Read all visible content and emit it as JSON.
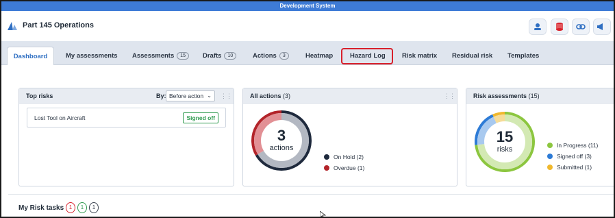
{
  "environment_banner": "Development System",
  "app": {
    "title": "Part 145 Operations"
  },
  "header_buttons": [
    {
      "name": "user-hat-icon"
    },
    {
      "name": "database-icon"
    },
    {
      "name": "link-icon"
    },
    {
      "name": "megaphone-icon"
    }
  ],
  "tabs": [
    {
      "label": "Dashboard",
      "count": null,
      "active": true
    },
    {
      "label": "My assessments",
      "count": null
    },
    {
      "label": "Assessments",
      "count": "15"
    },
    {
      "label": "Drafts",
      "count": "10"
    },
    {
      "label": "Actions",
      "count": "3"
    },
    {
      "label": "Heatmap",
      "count": null
    },
    {
      "label": "Hazard Log",
      "count": null,
      "highlighted": true
    },
    {
      "label": "Risk matrix",
      "count": null
    },
    {
      "label": "Residual risk",
      "count": null
    },
    {
      "label": "Templates",
      "count": null
    }
  ],
  "top_risks": {
    "title": "Top risks",
    "by_label": "By:",
    "by_value": "Before action",
    "rows": [
      {
        "name": "Lost Tool on Aircraft",
        "status": "Signed off"
      }
    ]
  },
  "all_actions": {
    "title": "All actions",
    "count": "(3)",
    "total": "3",
    "unit": "actions",
    "legend": [
      {
        "label": "On Hold (2)",
        "value": 2,
        "color": "#1f2a3d"
      },
      {
        "label": "Overdue (1)",
        "value": 1,
        "color": "#b3242a"
      }
    ]
  },
  "risk_assessments": {
    "title": "Risk assessments",
    "count": "(15)",
    "total": "15",
    "unit": "risks",
    "legend": [
      {
        "label": "In Progress (11)",
        "value": 11,
        "color": "#8cc63f"
      },
      {
        "label": "Signed off (3)",
        "value": 3,
        "color": "#2d7bd6"
      },
      {
        "label": "Submitted (1)",
        "value": 1,
        "color": "#f0b82d"
      }
    ]
  },
  "my_risk_tasks": {
    "title": "My Risk tasks",
    "pills": [
      {
        "value": "1",
        "color": "#d8202b"
      },
      {
        "value": "1",
        "color": "#2f9a4f"
      },
      {
        "value": "1",
        "color": "#3a4250"
      }
    ]
  }
}
